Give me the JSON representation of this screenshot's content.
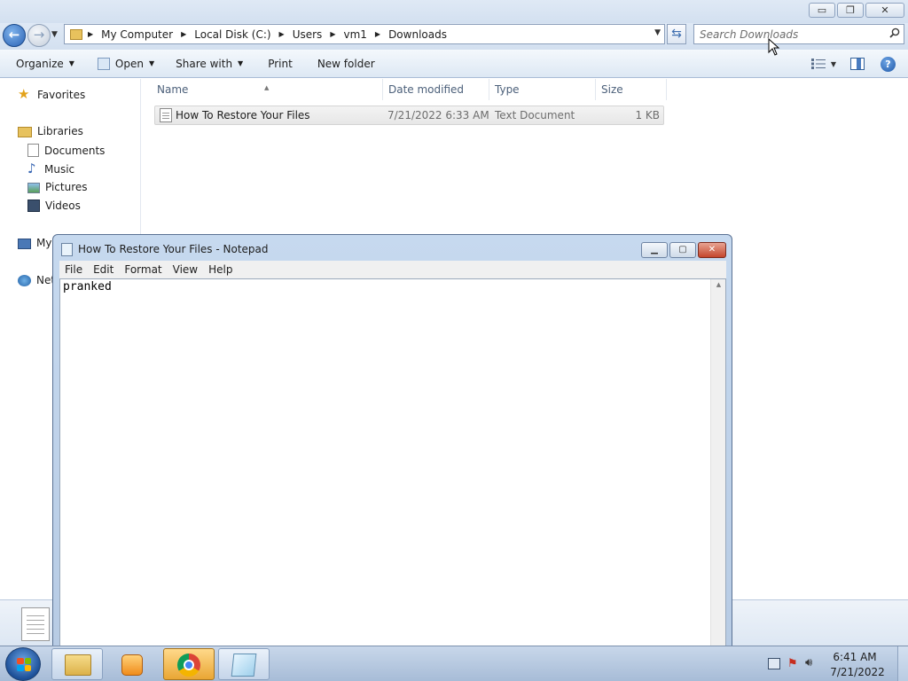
{
  "explorer": {
    "window_buttons": {
      "minimize": "▭",
      "restore": "❐",
      "close": "✕"
    },
    "breadcrumb": [
      "My Computer",
      "Local Disk (C:)",
      "Users",
      "vm1",
      "Downloads"
    ],
    "search": {
      "placeholder": "Search Downloads"
    },
    "toolbar": {
      "organize": "Organize",
      "open": "Open",
      "share_with": "Share with",
      "print": "Print",
      "new_folder": "New folder"
    },
    "nav": {
      "favorites": "Favorites",
      "libraries": "Libraries",
      "documents": "Documents",
      "music": "Music",
      "pictures": "Pictures",
      "videos": "Videos",
      "computer": "My",
      "network": "Net"
    },
    "columns": {
      "name": "Name",
      "date_modified": "Date modified",
      "type": "Type",
      "size": "Size"
    },
    "files": [
      {
        "name": "How To Restore Your Files",
        "date_modified": "7/21/2022 6:33 AM",
        "type": "Text Document",
        "size": "1 KB"
      }
    ]
  },
  "notepad": {
    "title": "How To Restore Your Files - Notepad",
    "menu": [
      "File",
      "Edit",
      "Format",
      "View",
      "Help"
    ],
    "content": "pranked"
  },
  "taskbar": {
    "apps": [
      "explorer-icon",
      "media-player-icon",
      "chrome-icon",
      "notepad-icon"
    ],
    "clock": {
      "time": "6:41 AM",
      "date": "7/21/2022"
    }
  },
  "colors": {
    "accent": "#2a62b4",
    "close_red": "#c4452c",
    "taskbar": "#a7bcd7",
    "active_task": "#e9a634"
  }
}
